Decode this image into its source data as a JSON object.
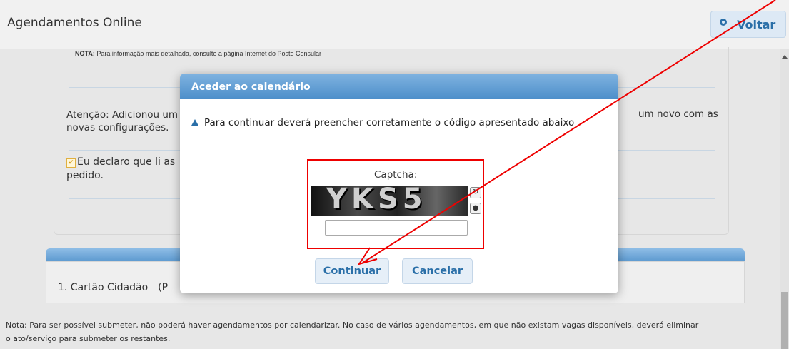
{
  "header": {
    "title": "Agendamentos Online",
    "back_label": "Voltar"
  },
  "page": {
    "note_top_bold": "NOTA:",
    "note_top": " Para informação mais detalhada, consulte a página Internet do Posto Consular",
    "attention_left": "Atenção: Adicionou um novas configurações.",
    "attention_right": "um novo com as",
    "declare_text": "Eu declaro que li as",
    "declare_text2": "pedido.",
    "declare_checked": true,
    "doc_item": "1. Cartão Cidadão",
    "doc_item_tail": "(P",
    "note_bottom": "Nota: Para ser possível submeter, não poderá haver agendamentos por calendarizar. No caso de vários agendamentos, em que não existam vagas disponíveis, deverá eliminar o ato/serviço para submeter os restantes."
  },
  "modal": {
    "title": "Aceder ao calendário",
    "message": "Para continuar deverá preencher corretamente o código apresentado abaixo",
    "captcha_label": "Captcha:",
    "captcha_text": "YKS5",
    "captcha_input_value": "",
    "continue_label": "Continuar",
    "cancel_label": "Cancelar"
  },
  "icons": {
    "back": "circle-icon",
    "warning": "warning-triangle-icon",
    "refresh": "refresh-icon",
    "audio": "audio-icon"
  },
  "colors": {
    "accent": "#2a6fa8",
    "modal_header": "#5d9ad0",
    "annotation": "#e00000"
  }
}
